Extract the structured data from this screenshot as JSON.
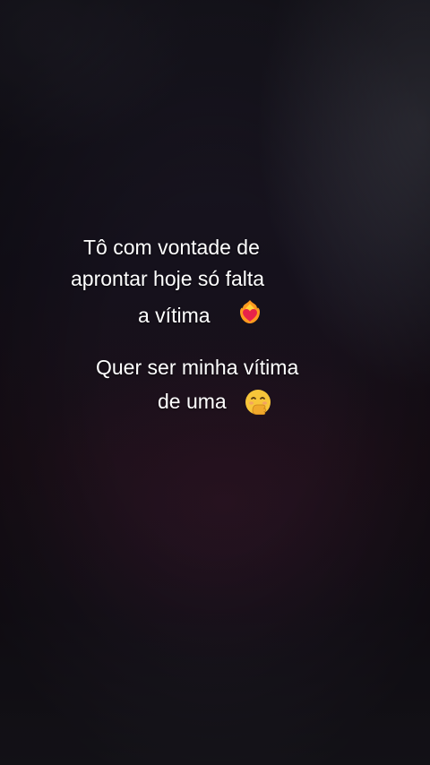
{
  "caption_1": {
    "line_1": "Tô com vontade de",
    "line_2": "aprontar hoje só falta",
    "line_3": "a vítima",
    "emoji": "heart-on-fire-icon"
  },
  "caption_2": {
    "line_1": "Quer ser minha vítima",
    "line_2": "de uma",
    "emoji": "face-hand-over-mouth-icon"
  },
  "colors": {
    "text": "#ffffff",
    "background": "#15111c"
  }
}
